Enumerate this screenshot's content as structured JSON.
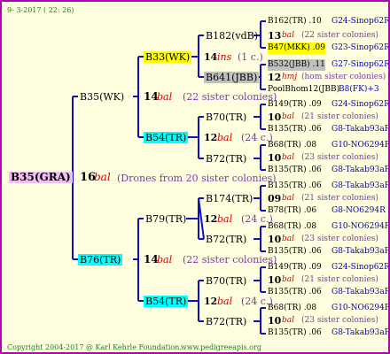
{
  "header": {
    "date": "9- 3-2017 ( 22: 26)"
  },
  "footer": {
    "copyright": "Copyright 2004-2017 @ Karl Kehrle Foundation.",
    "site": "www.pedigreeapis.org"
  },
  "colors": {
    "border": "#b000b0",
    "background": "#ffffe0",
    "lines": "#1010c0",
    "pink": "#f0c0f0",
    "yellow": "#ffff00",
    "cyan": "#00ffff",
    "grey": "#c0c0c0"
  },
  "gen0": {
    "name": "B35(GRA)",
    "year": "16",
    "tag": "bal",
    "note": "(Drones from 20 sister colonies)"
  },
  "gen1": [
    {
      "name": "B35(WK)",
      "year": "14",
      "tag": "bal",
      "note": "(22 sister colonies)"
    },
    {
      "name": "B76(TR)",
      "year": "14",
      "tag": "bal",
      "note": "(22 sister colonies)"
    }
  ],
  "gen2": [
    {
      "name": "B33(WK)",
      "year": "14",
      "tag": "ins",
      "note": "(1 c.)"
    },
    {
      "name": "B54(TR)",
      "year": "12",
      "tag": "bal",
      "note": "(24 c.)"
    },
    {
      "name": "B79(TR)",
      "year": "12",
      "tag": "bal",
      "note": "(24 c.)"
    },
    {
      "name": "B54(TR)",
      "year": "12",
      "tag": "bal",
      "note": "(24 c.)"
    }
  ],
  "gen3": [
    {
      "name": "B182(vdB)"
    },
    {
      "name": "B641(JBB)"
    },
    {
      "name": "B70(TR)"
    },
    {
      "name": "B72(TR)"
    },
    {
      "name": "B174(TR)"
    },
    {
      "name": "B72(TR)"
    },
    {
      "name": "B70(TR)"
    },
    {
      "name": "B72(TR)"
    }
  ],
  "gen4": [
    {
      "line": "B162(TR) .10",
      "code": "G24-Sinop62R"
    },
    {
      "line": "13",
      "tag": "bal",
      "note": "(22 sister colonies)"
    },
    {
      "line": "B47(MKK) .09",
      "code": "G23-Sinop62R"
    },
    {
      "line": "B532(JBB) .11",
      "code": "G27-Sinop62R"
    },
    {
      "line": "12",
      "tag": "hmj",
      "note": "(hom sister colonies)"
    },
    {
      "line": "PoolBhom12(JBB)",
      "code": "B8(FK)+3"
    },
    {
      "line": "B149(TR) .09",
      "code": "G24-Sinop62R"
    },
    {
      "line": "10",
      "tag": "bal",
      "note": "(21 sister colonies)"
    },
    {
      "line": "B135(TR) .06",
      "code": "G8-Takab93aR"
    },
    {
      "line": "B68(TR) .08",
      "code": "G10-NO6294R"
    },
    {
      "line": "10",
      "tag": "bal",
      "note": "(23 sister colonies)"
    },
    {
      "line": "B135(TR) .06",
      "code": "G8-Takab93aR"
    },
    {
      "line": "B135(TR) .06",
      "code": "G8-Takab93aR"
    },
    {
      "line": "09",
      "tag": "bal",
      "note": "(21 sister colonies)"
    },
    {
      "line": "B78(TR) .06",
      "code": "G8-NO6294R"
    },
    {
      "line": "B68(TR) .08",
      "code": "G10-NO6294R"
    },
    {
      "line": "10",
      "tag": "bal",
      "note": "(23 sister colonies)"
    },
    {
      "line": "B135(TR) .06",
      "code": "G8-Takab93aR"
    },
    {
      "line": "B149(TR) .09",
      "code": "G24-Sinop62R"
    },
    {
      "line": "10",
      "tag": "bal",
      "note": "(21 sister colonies)"
    },
    {
      "line": "B135(TR) .06",
      "code": "G8-Takab93aR"
    },
    {
      "line": "B68(TR) .08",
      "code": "G10-NO6294R"
    },
    {
      "line": "10",
      "tag": "bal",
      "note": "(23 sister colonies)"
    },
    {
      "line": "B135(TR) .06",
      "code": "G8-Takab93aR"
    }
  ]
}
